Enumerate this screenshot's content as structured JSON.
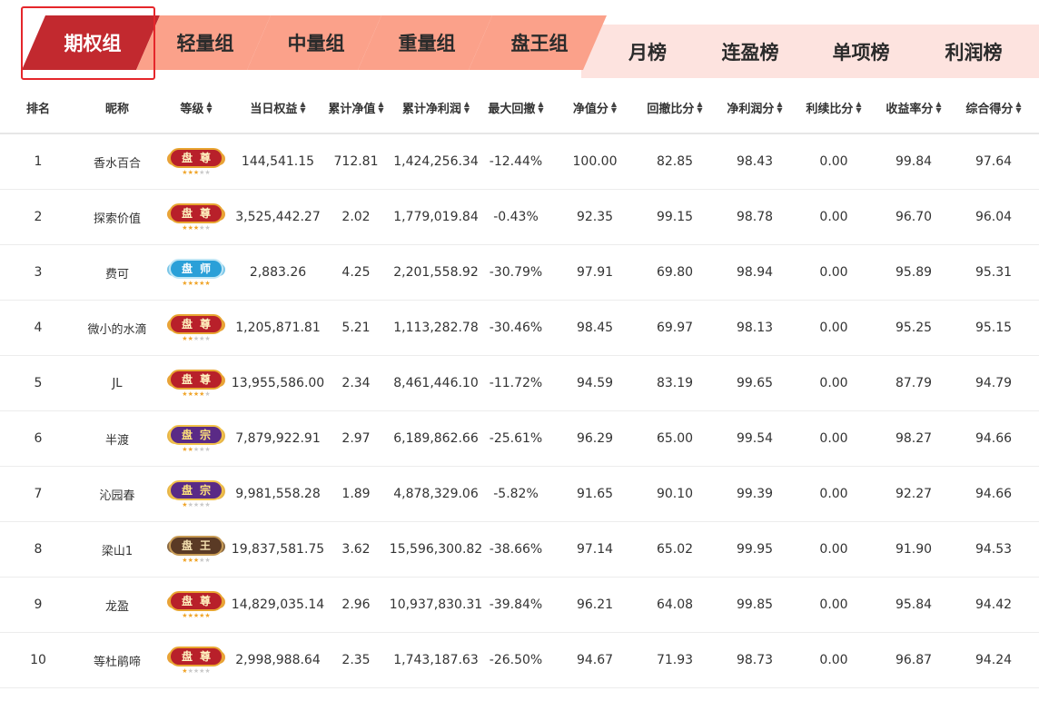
{
  "group_tabs": [
    {
      "label": "期权组",
      "active": true
    },
    {
      "label": "轻量组",
      "active": false
    },
    {
      "label": "中量组",
      "active": false
    },
    {
      "label": "重量组",
      "active": false
    },
    {
      "label": "盘王组",
      "active": false
    }
  ],
  "rank_tabs": [
    {
      "label": "月榜"
    },
    {
      "label": "连盈榜"
    },
    {
      "label": "单项榜"
    },
    {
      "label": "利润榜"
    }
  ],
  "colors": {
    "active_tab": "#c2292f",
    "inactive_tab": "#fba18a",
    "band": "#fde3df",
    "outline": "#e5262b"
  },
  "sort_icon": {
    "up": "▲",
    "down": "▼"
  },
  "columns": [
    {
      "label": "排名",
      "sortable": false
    },
    {
      "label": "昵称",
      "sortable": false
    },
    {
      "label": "等级",
      "sortable": true
    },
    {
      "label": "当日权益",
      "sortable": true
    },
    {
      "label": "累计净值",
      "sortable": true
    },
    {
      "label": "累计净利润",
      "sortable": true
    },
    {
      "label": "最大回撤",
      "sortable": true
    },
    {
      "label": "净值分",
      "sortable": true
    },
    {
      "label": "回撤比分",
      "sortable": true
    },
    {
      "label": "净利润分",
      "sortable": true
    },
    {
      "label": "利续比分",
      "sortable": true
    },
    {
      "label": "收益率分",
      "sortable": true
    },
    {
      "label": "综合得分",
      "sortable": true
    }
  ],
  "badge_levels": {
    "pz": {
      "chars": "盘尊",
      "icon": "level-panzun-badge-icon"
    },
    "ps": {
      "chars": "盘师",
      "icon": "level-panshi-badge-icon"
    },
    "pzong": {
      "chars": "盘宗",
      "icon": "level-panzong-badge-icon"
    },
    "pw": {
      "chars": "盘王",
      "icon": "level-panwang-badge-icon"
    }
  },
  "rows": [
    {
      "rank": "1",
      "nickname": "香水百合",
      "level": "pz",
      "stars": 3,
      "daily_equity": "144,541.15",
      "cum_nav": "712.81",
      "cum_profit": "1,424,256.34",
      "max_drawdown": "-12.44%",
      "nav_score": "100.00",
      "drawdown_score": "82.85",
      "profit_score": "98.43",
      "continuity_score": "0.00",
      "return_score": "99.84",
      "total_score": "97.64"
    },
    {
      "rank": "2",
      "nickname": "探索价值",
      "level": "pz",
      "stars": 3,
      "daily_equity": "3,525,442.27",
      "cum_nav": "2.02",
      "cum_profit": "1,779,019.84",
      "max_drawdown": "-0.43%",
      "nav_score": "92.35",
      "drawdown_score": "99.15",
      "profit_score": "98.78",
      "continuity_score": "0.00",
      "return_score": "96.70",
      "total_score": "96.04"
    },
    {
      "rank": "3",
      "nickname": "费可",
      "level": "ps",
      "stars": 5,
      "daily_equity": "2,883.26",
      "cum_nav": "4.25",
      "cum_profit": "2,201,558.92",
      "max_drawdown": "-30.79%",
      "nav_score": "97.91",
      "drawdown_score": "69.80",
      "profit_score": "98.94",
      "continuity_score": "0.00",
      "return_score": "95.89",
      "total_score": "95.31"
    },
    {
      "rank": "4",
      "nickname": "微小的水滴",
      "level": "pz",
      "stars": 2,
      "daily_equity": "1,205,871.81",
      "cum_nav": "5.21",
      "cum_profit": "1,113,282.78",
      "max_drawdown": "-30.46%",
      "nav_score": "98.45",
      "drawdown_score": "69.97",
      "profit_score": "98.13",
      "continuity_score": "0.00",
      "return_score": "95.25",
      "total_score": "95.15"
    },
    {
      "rank": "5",
      "nickname": "JL",
      "level": "pz",
      "stars": 4,
      "daily_equity": "13,955,586.00",
      "cum_nav": "2.34",
      "cum_profit": "8,461,446.10",
      "max_drawdown": "-11.72%",
      "nav_score": "94.59",
      "drawdown_score": "83.19",
      "profit_score": "99.65",
      "continuity_score": "0.00",
      "return_score": "87.79",
      "total_score": "94.79"
    },
    {
      "rank": "6",
      "nickname": "半渡",
      "level": "pzong",
      "stars": 2,
      "daily_equity": "7,879,922.91",
      "cum_nav": "2.97",
      "cum_profit": "6,189,862.66",
      "max_drawdown": "-25.61%",
      "nav_score": "96.29",
      "drawdown_score": "65.00",
      "profit_score": "99.54",
      "continuity_score": "0.00",
      "return_score": "98.27",
      "total_score": "94.66"
    },
    {
      "rank": "7",
      "nickname": "沁园春",
      "level": "pzong",
      "stars": 1,
      "daily_equity": "9,981,558.28",
      "cum_nav": "1.89",
      "cum_profit": "4,878,329.06",
      "max_drawdown": "-5.82%",
      "nav_score": "91.65",
      "drawdown_score": "90.10",
      "profit_score": "99.39",
      "continuity_score": "0.00",
      "return_score": "92.27",
      "total_score": "94.66"
    },
    {
      "rank": "8",
      "nickname": "梁山1",
      "level": "pw",
      "stars": 3,
      "daily_equity": "19,837,581.75",
      "cum_nav": "3.62",
      "cum_profit": "15,596,300.82",
      "max_drawdown": "-38.66%",
      "nav_score": "97.14",
      "drawdown_score": "65.02",
      "profit_score": "99.95",
      "continuity_score": "0.00",
      "return_score": "91.90",
      "total_score": "94.53"
    },
    {
      "rank": "9",
      "nickname": "龙盈",
      "level": "pz",
      "stars": 5,
      "daily_equity": "14,829,035.14",
      "cum_nav": "2.96",
      "cum_profit": "10,937,830.31",
      "max_drawdown": "-39.84%",
      "nav_score": "96.21",
      "drawdown_score": "64.08",
      "profit_score": "99.85",
      "continuity_score": "0.00",
      "return_score": "95.84",
      "total_score": "94.42"
    },
    {
      "rank": "10",
      "nickname": "等杜鹃啼",
      "level": "pz",
      "stars": 1,
      "daily_equity": "2,998,988.64",
      "cum_nav": "2.35",
      "cum_profit": "1,743,187.63",
      "max_drawdown": "-26.50%",
      "nav_score": "94.67",
      "drawdown_score": "71.93",
      "profit_score": "98.73",
      "continuity_score": "0.00",
      "return_score": "96.87",
      "total_score": "94.24"
    }
  ]
}
